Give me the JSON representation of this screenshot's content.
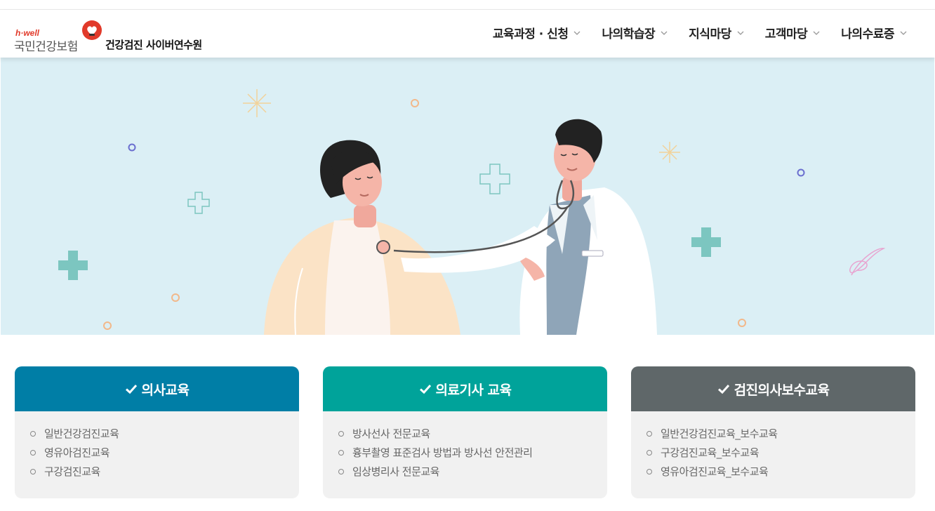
{
  "header": {
    "brand_small": "h·well",
    "brand_main": "국민건강보험",
    "site_title": "건강검진 사이버연수원"
  },
  "nav": [
    {
      "label": "교육과정 · 신청"
    },
    {
      "label": "나의학습장"
    },
    {
      "label": "지식마당"
    },
    {
      "label": "고객마당"
    },
    {
      "label": "나의수료증"
    }
  ],
  "cards": [
    {
      "title": "의사교육",
      "color": "#007ea6",
      "items": [
        "일반건강검진교육",
        "영유아검진교육",
        "구강검진교육"
      ]
    },
    {
      "title": "의료기사 교육",
      "color": "#00a39a",
      "items": [
        "방사선사 전문교육",
        "흉부촬영 표준검사 방법과 방사선 안전관리",
        "임상병리사 전문교육"
      ]
    },
    {
      "title": "검진의사보수교육",
      "color": "#5f6769",
      "items": [
        "일반건강검진교육_보수교육",
        "구강검진교육_보수교육",
        "영유아검진교육_보수교육"
      ]
    }
  ],
  "colors": {
    "hero_bg": "#dbeff5",
    "brand_red": "#e13a2a"
  },
  "icons": {
    "nav_dropdown": "chevron-down-icon",
    "card_check": "check-icon",
    "list_bullet": "circle-bullet-icon"
  }
}
